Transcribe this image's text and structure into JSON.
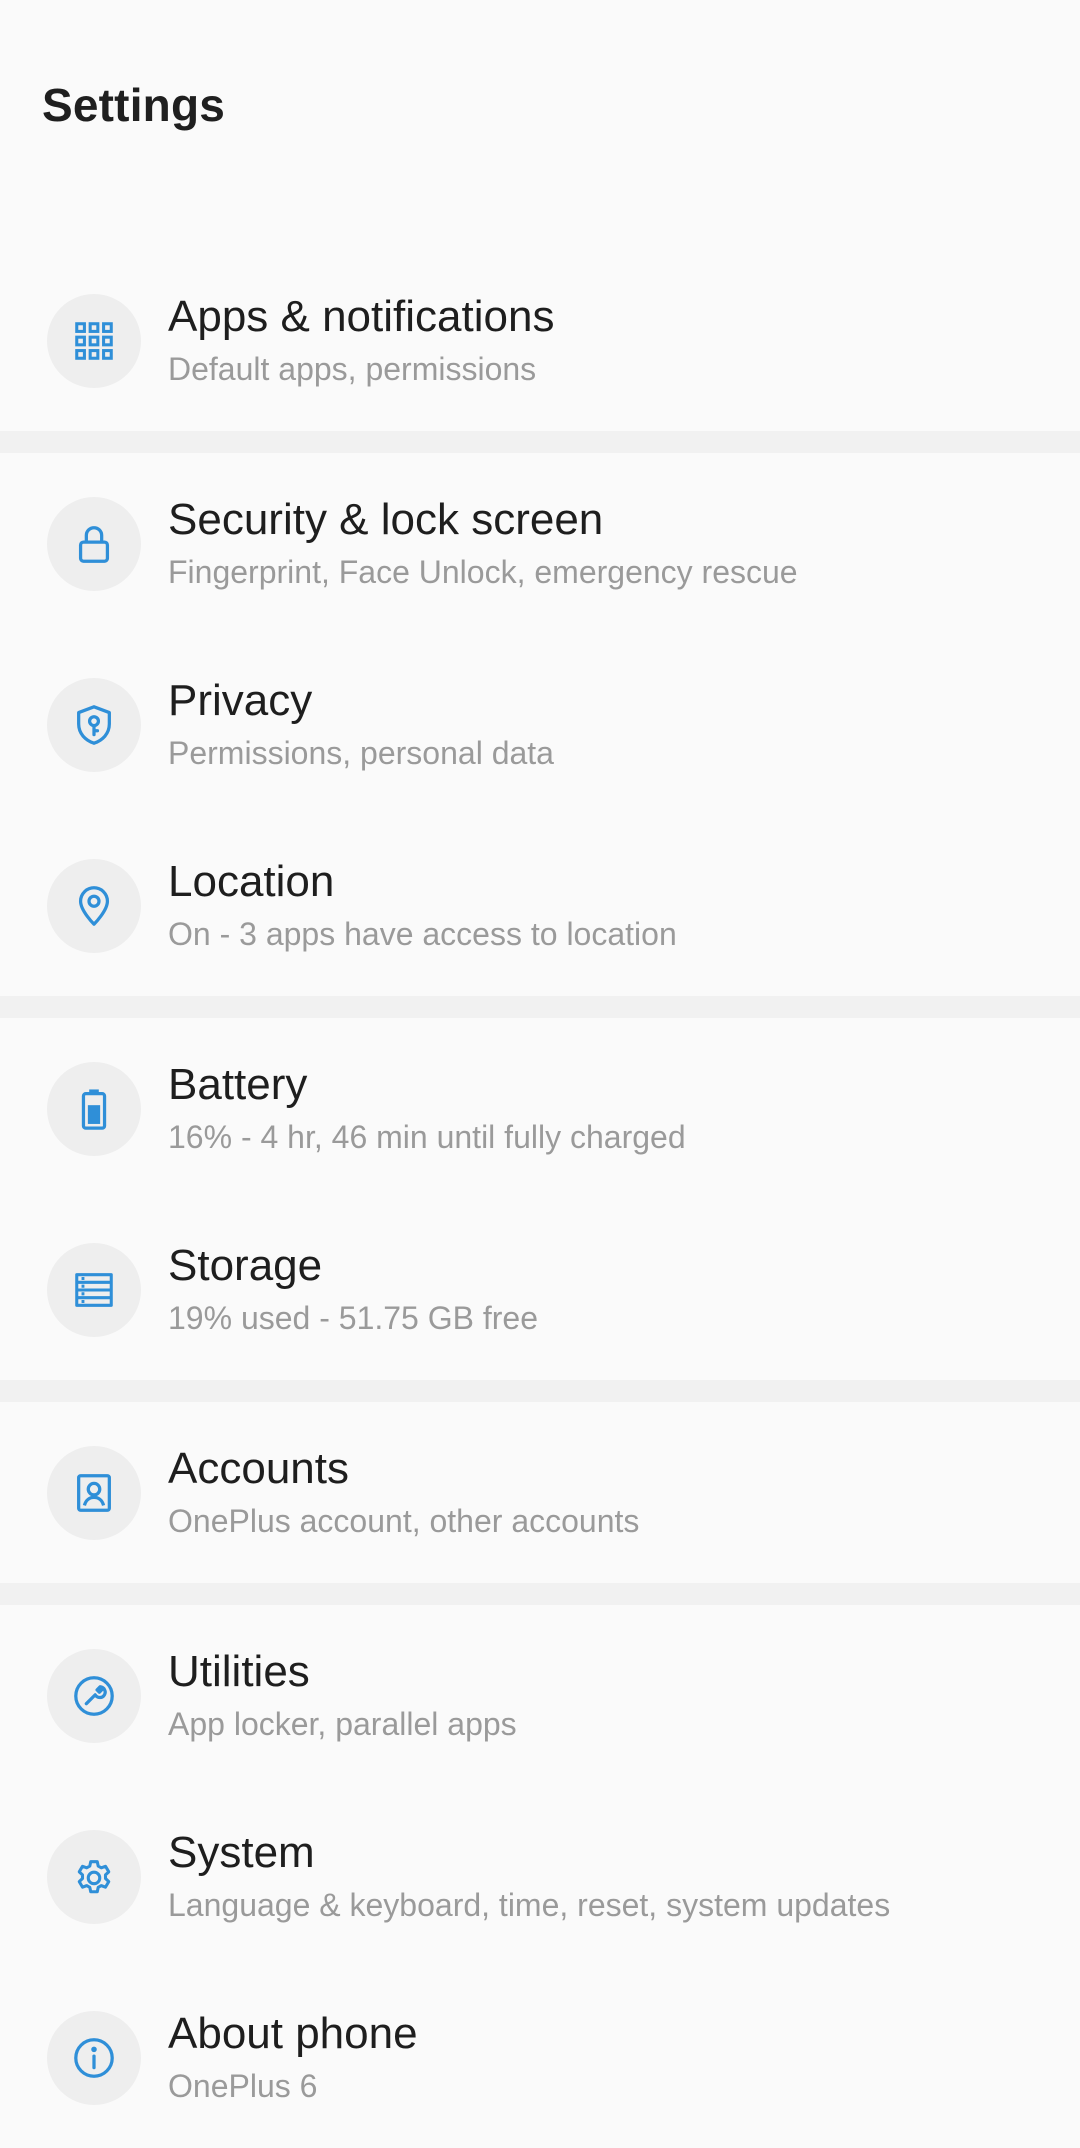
{
  "header": {
    "title": "Settings"
  },
  "colors": {
    "accent": "#2f8fd8",
    "icon_bg": "#eeeeee",
    "divider": "#f1f1f1",
    "subtitle": "#9a9a9a"
  },
  "groups": [
    {
      "items": [
        {
          "title": "Apps & notifications",
          "subtitle": "Default apps, permissions",
          "icon": "apps-grid-icon"
        }
      ]
    },
    {
      "items": [
        {
          "title": "Security & lock screen",
          "subtitle": "Fingerprint, Face Unlock, emergency rescue",
          "icon": "lock-icon"
        },
        {
          "title": "Privacy",
          "subtitle": "Permissions, personal data",
          "icon": "shield-key-icon"
        },
        {
          "title": "Location",
          "subtitle": "On - 3 apps have access to location",
          "icon": "location-pin-icon"
        }
      ]
    },
    {
      "items": [
        {
          "title": "Battery",
          "subtitle": "16% - 4 hr, 46 min until fully charged",
          "icon": "battery-icon"
        },
        {
          "title": "Storage",
          "subtitle": "19% used - 51.75 GB free",
          "icon": "storage-icon"
        }
      ]
    },
    {
      "items": [
        {
          "title": "Accounts",
          "subtitle": "OnePlus account, other accounts",
          "icon": "account-icon"
        }
      ]
    },
    {
      "items": [
        {
          "title": "Utilities",
          "subtitle": "App locker, parallel apps",
          "icon": "wrench-icon"
        },
        {
          "title": "System",
          "subtitle": "Language & keyboard, time, reset, system updates",
          "icon": "gear-icon"
        },
        {
          "title": "About phone",
          "subtitle": "OnePlus 6",
          "icon": "info-icon"
        }
      ]
    }
  ]
}
